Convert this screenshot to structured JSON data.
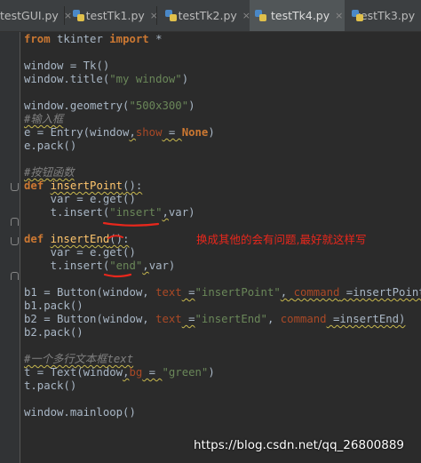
{
  "tabs": [
    {
      "label": "testGUI.py",
      "active": false
    },
    {
      "label": "testTk1.py",
      "active": false
    },
    {
      "label": "testTk2.py",
      "active": false
    },
    {
      "label": "testTk4.py",
      "active": true
    },
    {
      "label": "testTk3.py",
      "active": false
    }
  ],
  "tab_close_glyph": "×",
  "code": {
    "from": "from",
    "tkinter": " tkinter ",
    "import": "import",
    "star": " *",
    "l4": "window = Tk()",
    "l5a": "window.title(",
    "l5s": "\"my window\"",
    "l5b": ")",
    "l7a": "window.geometry(",
    "l7s": "\"500x300\"",
    "l7b": ")",
    "l8": "#输入框",
    "l9a": "e = Entry(window",
    "l9b": ",",
    "l9p": "show",
    "l9c": " = ",
    "l9k": "None",
    "l9d": ")",
    "l10": "e.pack()",
    "l12": "#按钮函数",
    "l13k": "def",
    "l13sp": " ",
    "l13f": "insertPoint",
    "l13b": "():",
    "l14": "    var = e.get()",
    "l15a": "    t.insert(",
    "l15s": "\"insert\"",
    "l15b": ",",
    "l15c": "var)",
    "l17k": "def",
    "l17sp": " ",
    "l17f": "insertEnd",
    "l17b": "():",
    "l18": "    var = e.get()",
    "l19a": "    t.insert(",
    "l19s": "\"end\"",
    "l19b": ",",
    "l19c": "var)",
    "l21a": "b1 = Button(window, ",
    "l21p": "text",
    "l21b": " =",
    "l21s": "\"insertPoint\"",
    "l21c": ", ",
    "l21p2": "command",
    "l21d": " =insertPoint)",
    "l22": "b1.pack()",
    "l23a": "b2 = Button(window, ",
    "l23p": "text",
    "l23b": " =",
    "l23s": "\"insertEnd\"",
    "l23c": ", ",
    "l23p2": "command",
    "l23d": " =insertEnd)",
    "l24": "b2.pack()",
    "l26": "#一个多行文本框text",
    "l27a": "t = Text(window",
    "l27b": ",",
    "l27p": "bg",
    "l27c": " = ",
    "l27s": "\"green\"",
    "l27d": ")",
    "l28": "t.pack()",
    "l30": "window.mainloop()"
  },
  "annotation": "换成其他的会有问题,最好就这样写",
  "watermark": "https://blog.csdn.net/qq_26800889",
  "colors": {
    "background": "#2b2b2b",
    "tabbar": "#3c3f41",
    "active_tab": "#515658",
    "keyword": "#cc7832",
    "string": "#6a8759",
    "comment": "#808080",
    "function": "#ffc66d",
    "param": "#aa4926",
    "annotation": "#e8271c"
  }
}
